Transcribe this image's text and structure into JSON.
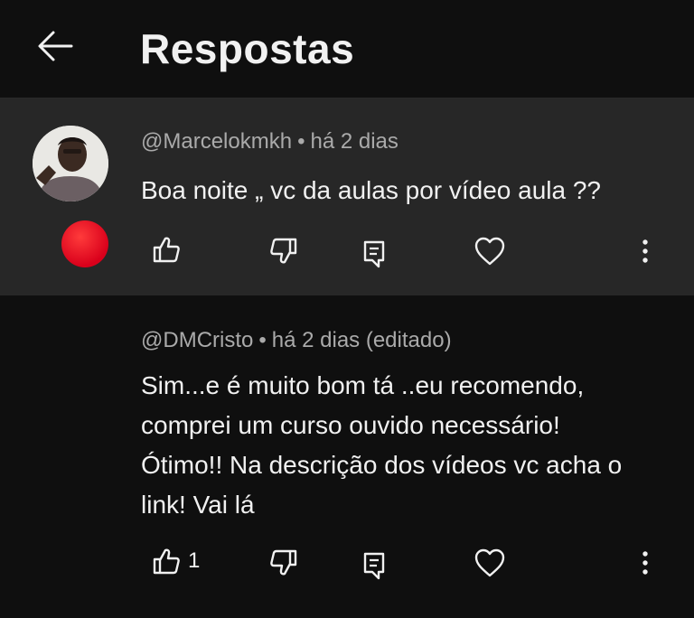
{
  "header": {
    "title": "Respostas"
  },
  "comment": {
    "author": "@Marcelokmkh",
    "time": "há 2 dias",
    "text": "Boa noite „ vc da aulas por vídeo aula ??"
  },
  "reply": {
    "author": "@DMCristo",
    "time": "há 2 dias (editado)",
    "text_lines": [
      "Sim...e é muito bom tá ..eu recomendo,",
      "comprei um curso ouvido necessário!",
      "Ótimo!! Na descrição dos vídeos vc acha o",
      "link! Vai lá"
    ],
    "like_count": "1"
  },
  "colors": {
    "background": "#0f0f0f",
    "highlight": "#272727",
    "meta": "#aaaaaa",
    "avatar_red": "#e0001b"
  },
  "icons": [
    "back-arrow-icon",
    "thumbs-up-icon",
    "thumbs-down-icon",
    "reply-icon",
    "heart-icon",
    "more-vert-icon"
  ]
}
